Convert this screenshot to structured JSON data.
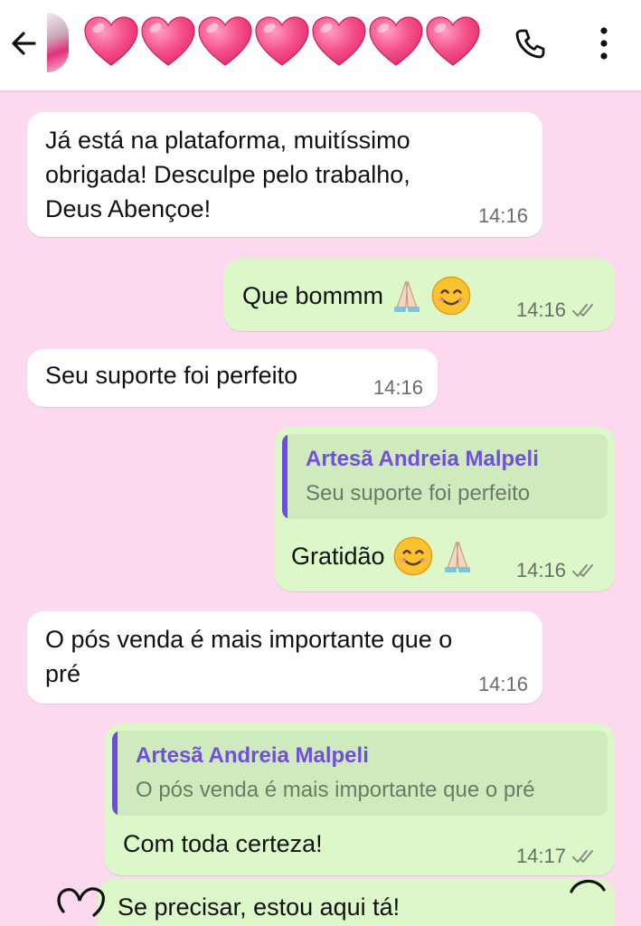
{
  "header": {
    "back_icon": "arrow-back-icon",
    "avatar_icon": "contact-avatar",
    "contact_name_icons": [
      "pink-heart-icon",
      "pink-heart-icon",
      "pink-heart-icon",
      "pink-heart-icon",
      "pink-heart-icon",
      "pink-heart-icon",
      "pink-heart-icon"
    ],
    "call_icon": "phone-icon",
    "menu_icon": "more-vertical-icon"
  },
  "messages": [
    {
      "direction": "in",
      "lines": [
        "Já está na plataforma, muitíssimo",
        "obrigada! Desculpe pelo trabalho,",
        "Deus Abençoe!"
      ],
      "time": "14:16"
    },
    {
      "direction": "out",
      "text": "Que bommm",
      "emojis": [
        "folded-hands-emoji",
        "smiling-face-emoji"
      ],
      "time": "14:16",
      "status": "read-ticks-icon"
    },
    {
      "direction": "in",
      "text": "Seu suporte foi perfeito",
      "time": "14:16"
    },
    {
      "direction": "out",
      "quote": {
        "author": "Artesã Andreia Malpeli",
        "text": "Seu suporte foi perfeito"
      },
      "text": "Gratidão",
      "emojis": [
        "smiling-face-emoji",
        "folded-hands-emoji"
      ],
      "time": "14:16",
      "status": "read-ticks-icon"
    },
    {
      "direction": "in",
      "lines": [
        "O pós venda é mais importante que o",
        "pré"
      ],
      "time": "14:16"
    },
    {
      "direction": "out",
      "quote": {
        "author": "Artesã Andreia Malpeli",
        "text": "O pós venda é mais importante que o pré"
      },
      "text": "Com toda certeza!",
      "time": "14:17",
      "status": "read-ticks-icon"
    },
    {
      "direction": "out",
      "text": "Se precisar, estou aqui tá!"
    }
  ],
  "colors": {
    "chat_background": "#fcd9ee",
    "incoming_bubble": "#ffffff",
    "outgoing_bubble": "#dcf8c8",
    "quote_author": "#7150d8",
    "heart": "#f0427f"
  }
}
